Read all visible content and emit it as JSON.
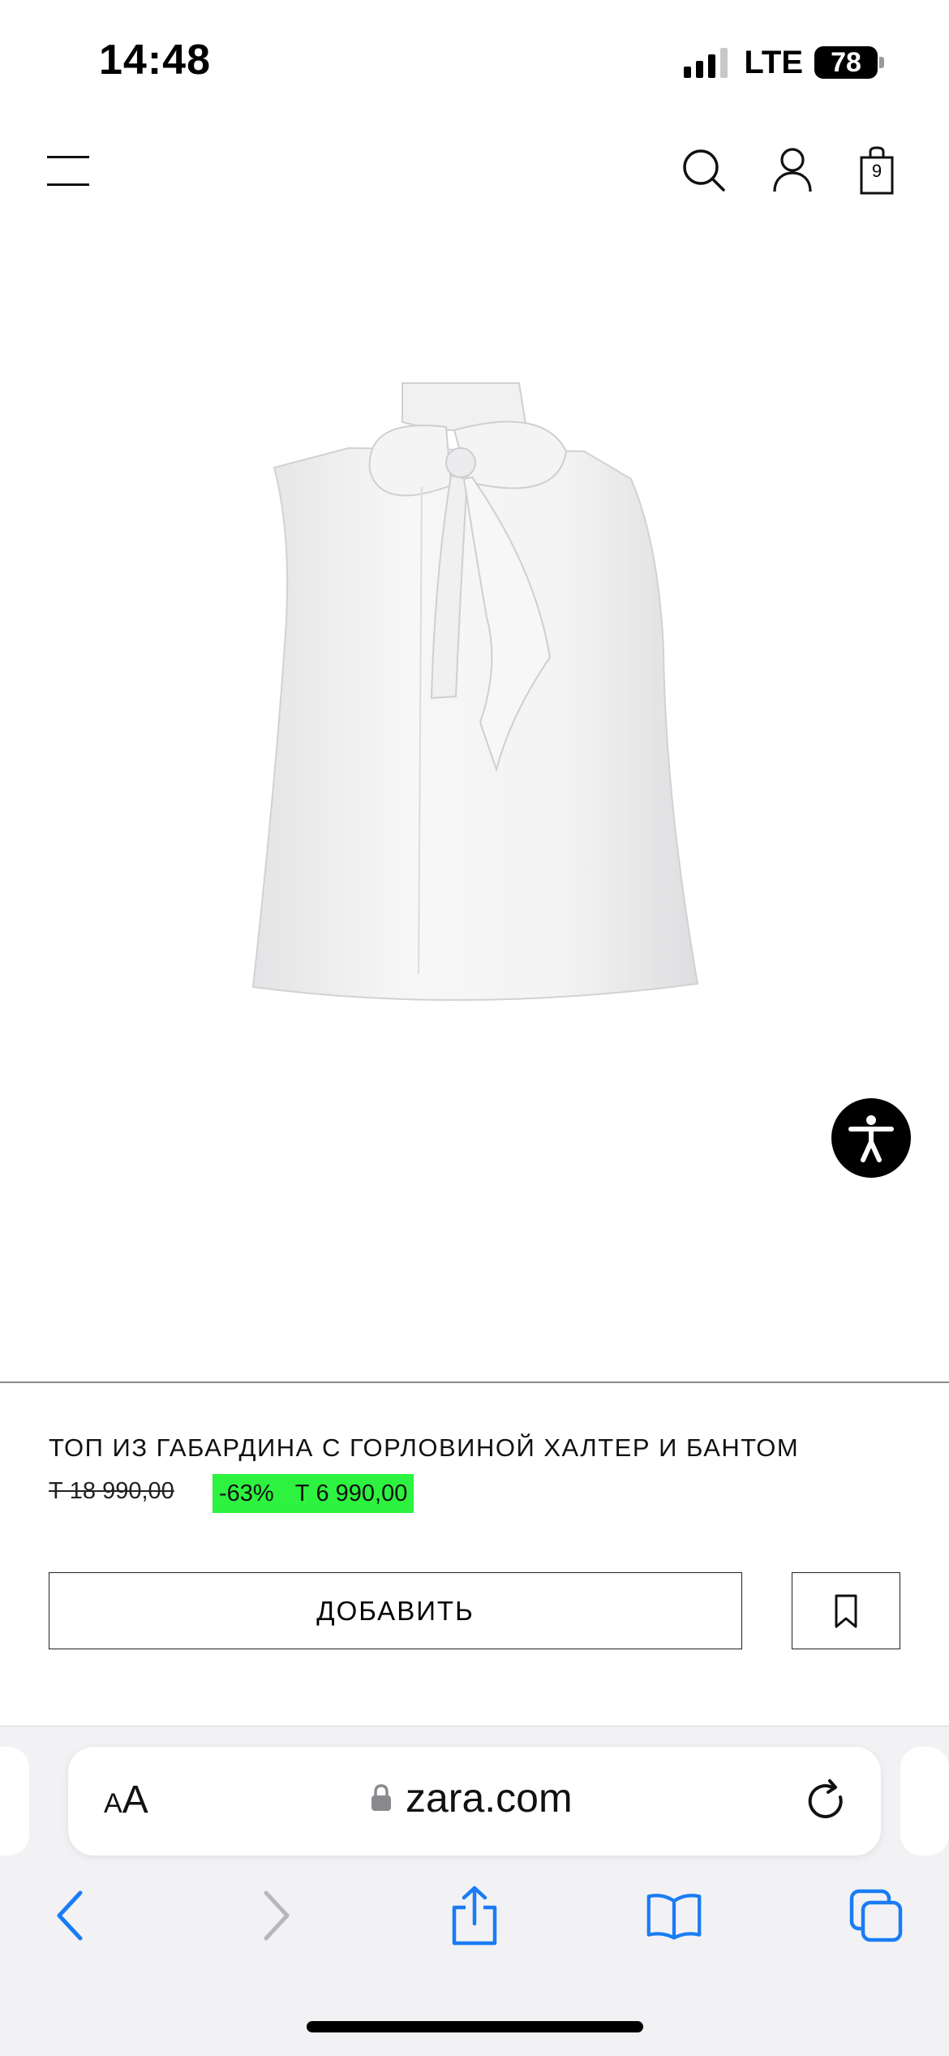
{
  "status_bar": {
    "time": "14:48",
    "network": "LTE",
    "battery": "78"
  },
  "header": {
    "cart_count": "9"
  },
  "product": {
    "title": "ТОП ИЗ ГАБАРДИНА С ГОРЛОВИНОЙ ХАЛТЕР И БАНТОМ",
    "old_price": "Т 18 990,00",
    "discount": "-63%",
    "new_price": "Т 6 990,00",
    "add_label": "ДОБАВИТЬ",
    "colors": {
      "sale_badge": "#2df23f"
    }
  },
  "browser": {
    "text_size_small": "A",
    "text_size_large": "A",
    "url": "zara.com",
    "accent": "#1a7cf5"
  }
}
